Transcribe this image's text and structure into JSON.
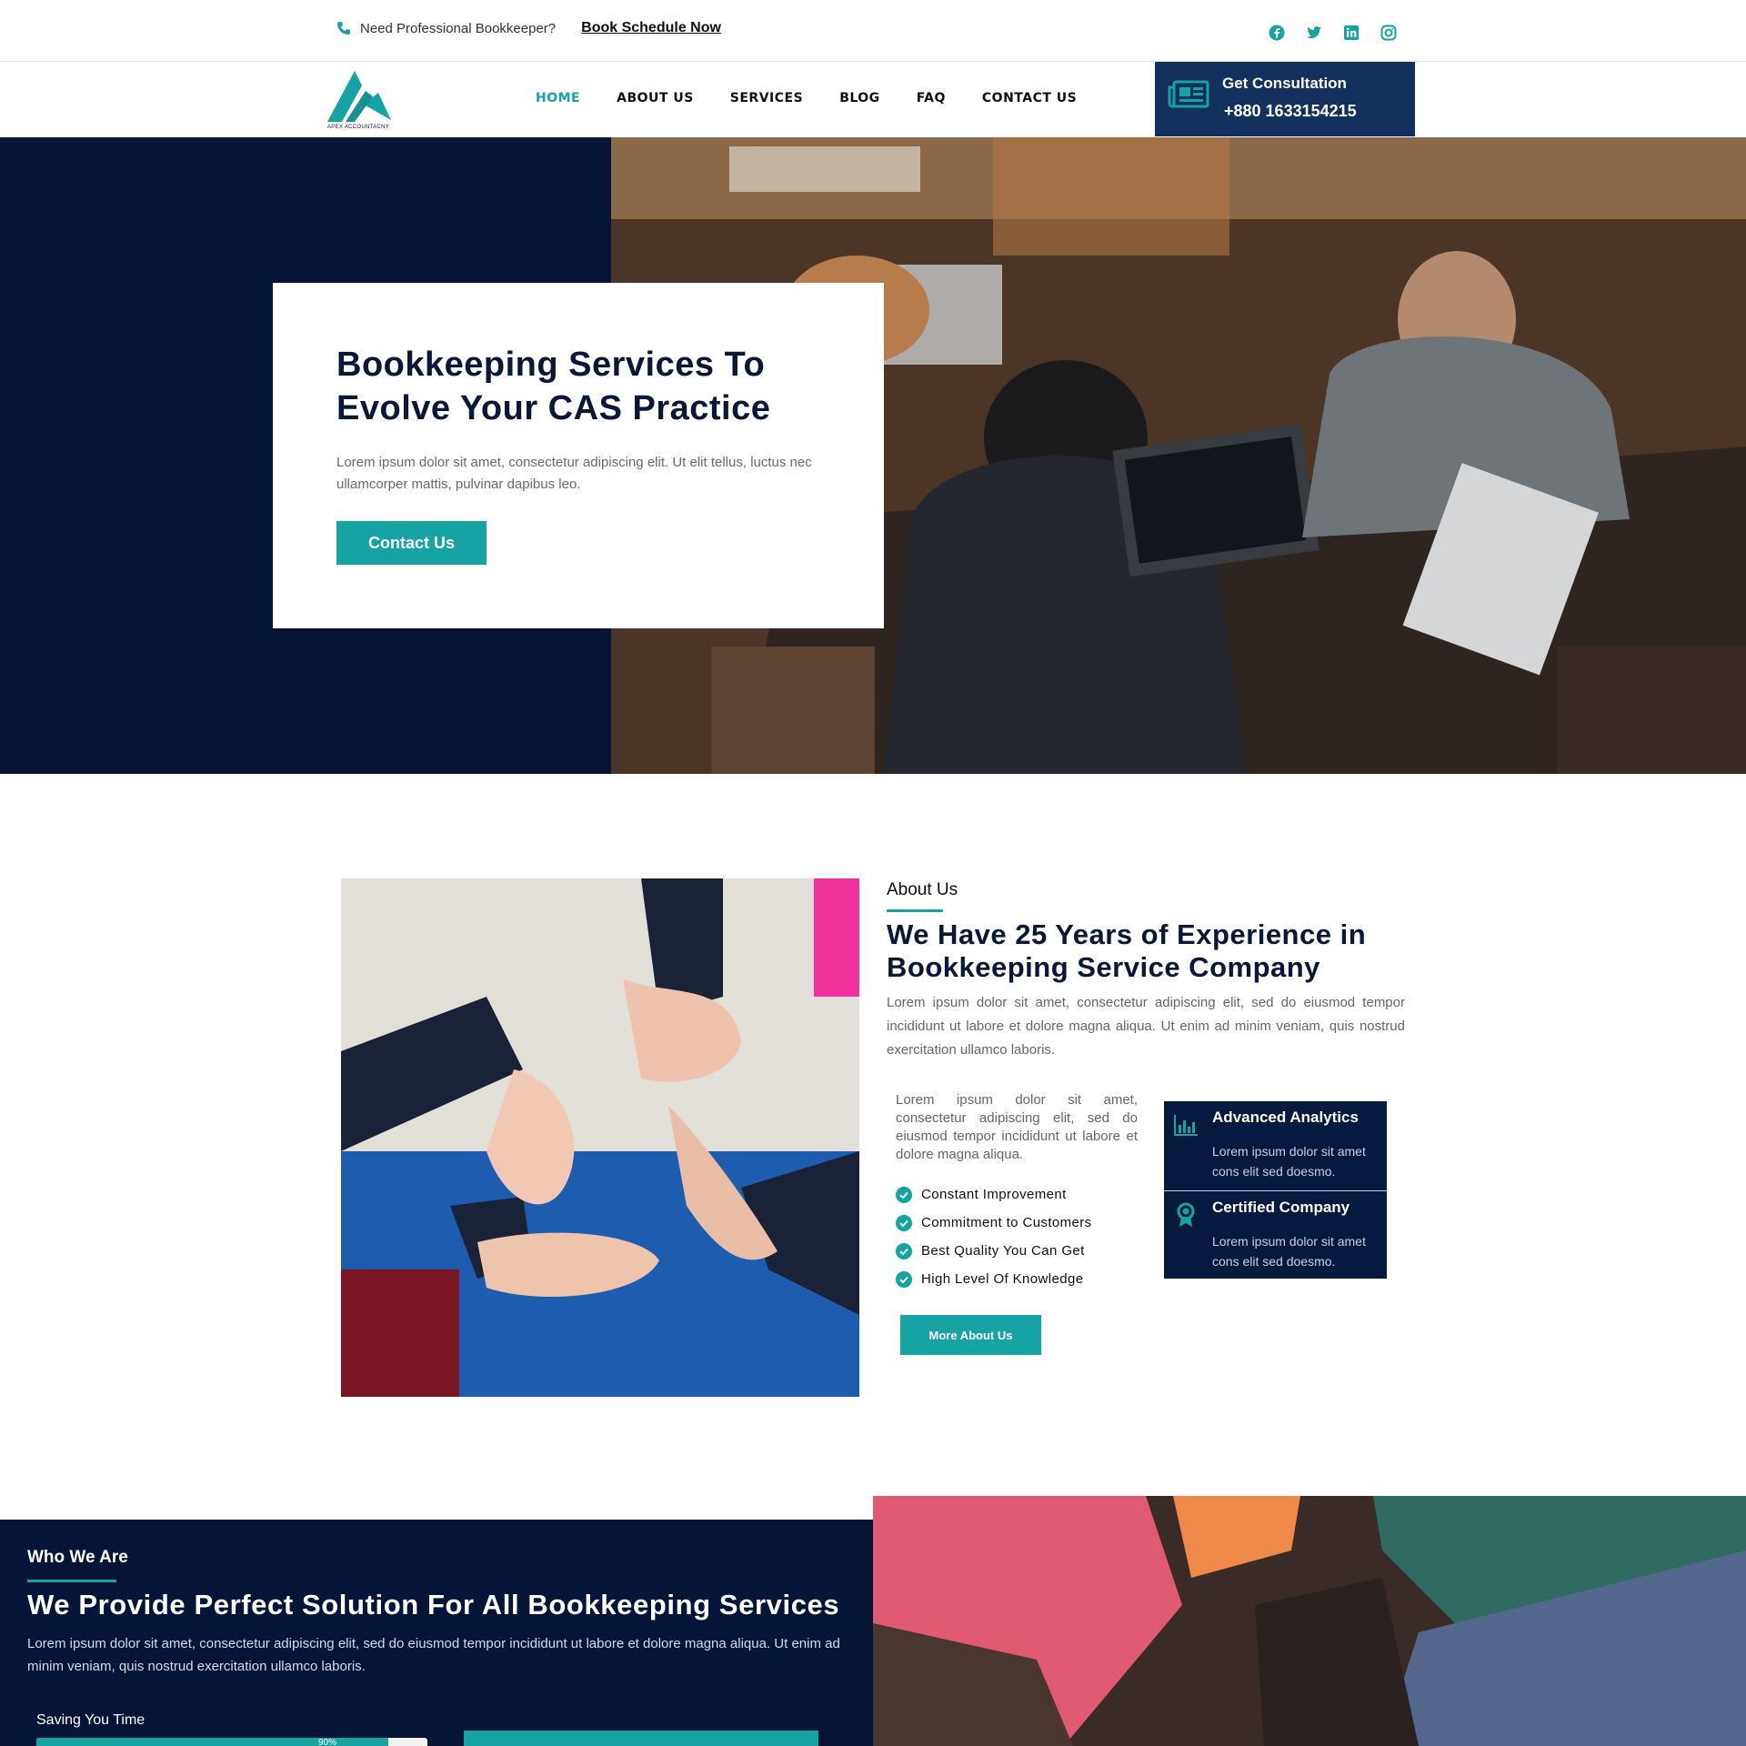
{
  "topbar": {
    "need_text": "Need Professional Bookkeeper?",
    "book_link": "Book Schedule Now",
    "socials": [
      "facebook-icon",
      "twitter-icon",
      "linkedin-icon",
      "instagram-icon"
    ]
  },
  "nav": {
    "logo_text": "APEX ACCOUNTACNY",
    "items": [
      "HOME",
      "ABOUT US",
      "SERVICES",
      "BLOG",
      "FAQ",
      "CONTACT US"
    ],
    "active": "HOME",
    "consult_title": "Get Consultation",
    "consult_phone": "+880 1633154215"
  },
  "hero": {
    "title": "Bookkeeping Services To Evolve Your CAS Practice",
    "text": "Lorem ipsum dolor sit amet, consectetur adipiscing elit. Ut elit tellus, luctus nec ullamcorper mattis, pulvinar dapibus leo.",
    "button": "Contact Us"
  },
  "about": {
    "label": "About Us",
    "title": "We Have 25 Years of Experience in Bookkeeping Service Company",
    "text": "Lorem ipsum dolor sit amet, consectetur adipiscing elit, sed do eiusmod tempor incididunt ut labore et dolore magna aliqua. Ut enim ad minim veniam, quis nostrud exercitation ullamco laboris.",
    "sub_text": "Lorem ipsum dolor sit amet, consectetur adipiscing elit, sed do eiusmod tempor incididunt ut labore et dolore magna aliqua.",
    "checks": [
      "Constant Improvement",
      "Commitment to Customers",
      "Best Quality You Can Get",
      "High Level Of Knowledge"
    ],
    "button": "More About Us",
    "features": [
      {
        "title": "Advanced Analytics",
        "text": "Lorem ipsum dolor sit amet cons elit sed doesmo.",
        "icon": "bar-chart-icon"
      },
      {
        "title": "Certified Company",
        "text": "Lorem ipsum dolor sit amet cons elit sed doesmo.",
        "icon": "award-ribbon-icon"
      }
    ]
  },
  "who": {
    "label": "Who We Are",
    "title": "We Provide Perfect Solution For All Bookkeeping Services",
    "text": "Lorem ipsum dolor sit amet, consectetur adipiscing elit, sed do eiusmod tempor incididunt ut labore et dolore magna aliqua. Ut enim ad minim veniam, quis nostrud exercitation ullamco laboris.",
    "progress_label": "Saving You Time",
    "progress_value": "90%",
    "progress_fraction": 0.9
  },
  "colors": {
    "accent": "#16a3a3",
    "navy": "#061537",
    "consult_bg": "#14305e"
  }
}
